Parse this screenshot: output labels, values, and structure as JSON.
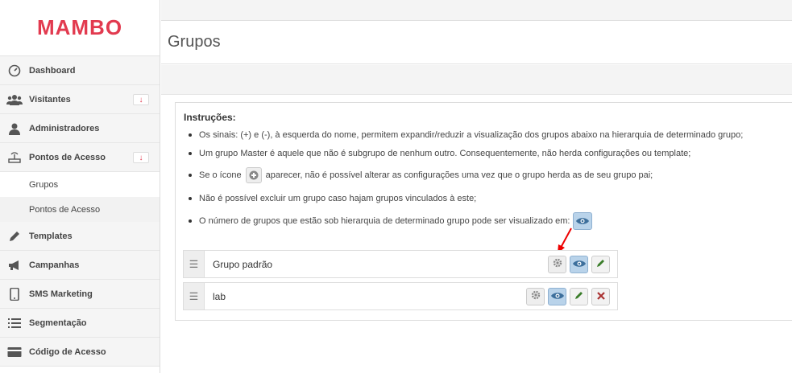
{
  "logo": {
    "text": "MAMBO",
    "color": "#e23a4f"
  },
  "sidebar": {
    "items": [
      {
        "label": "Dashboard",
        "icon": "dashboard-icon"
      },
      {
        "label": "Visitantes",
        "icon": "users-icon",
        "badge": "↓"
      },
      {
        "label": "Administradores",
        "icon": "user-icon"
      },
      {
        "label": "Pontos de Acesso",
        "icon": "router-icon",
        "badge": "↓"
      },
      {
        "label": "Templates",
        "icon": "pencil-icon"
      },
      {
        "label": "Campanhas",
        "icon": "megaphone-icon"
      },
      {
        "label": "SMS Marketing",
        "icon": "phone-icon"
      },
      {
        "label": "Segmentação",
        "icon": "list-icon"
      },
      {
        "label": "Código de Acesso",
        "icon": "card-icon"
      }
    ],
    "subitems": [
      {
        "label": "Grupos",
        "active": true
      },
      {
        "label": "Pontos de Acesso",
        "active": false
      }
    ]
  },
  "page": {
    "title": "Grupos"
  },
  "instructions": {
    "title": "Instruções:",
    "items": [
      "Os sinais: (+) e (-), à esquerda do nome, permitem expandir/reduzir a visualização dos grupos abaixo na hierarquia de determinado grupo;",
      "Um grupo Master é aquele que não é subgrupo de nenhum outro. Consequentemente, não herda configurações ou template;",
      "Se o ícone",
      "aparecer, não é possível alterar as configurações uma vez que o grupo herda as de seu grupo pai;",
      "Não é possível excluir um grupo caso hajam grupos vinculados à este;",
      "O número de grupos que estão sob hierarquia de determinado grupo pode ser visualizado em:"
    ]
  },
  "groups": [
    {
      "name": "Grupo padrão",
      "actions": [
        "gear-icon",
        "eye-icon",
        "pencil-icon"
      ]
    },
    {
      "name": "lab",
      "actions": [
        "gear-icon",
        "eye-icon",
        "pencil-icon",
        "close-icon"
      ]
    }
  ],
  "colors": {
    "accent": "#e23a4f",
    "eye_button": "#b9d3ea",
    "edit_icon": "#3a7d2a",
    "delete_icon": "#a33"
  }
}
